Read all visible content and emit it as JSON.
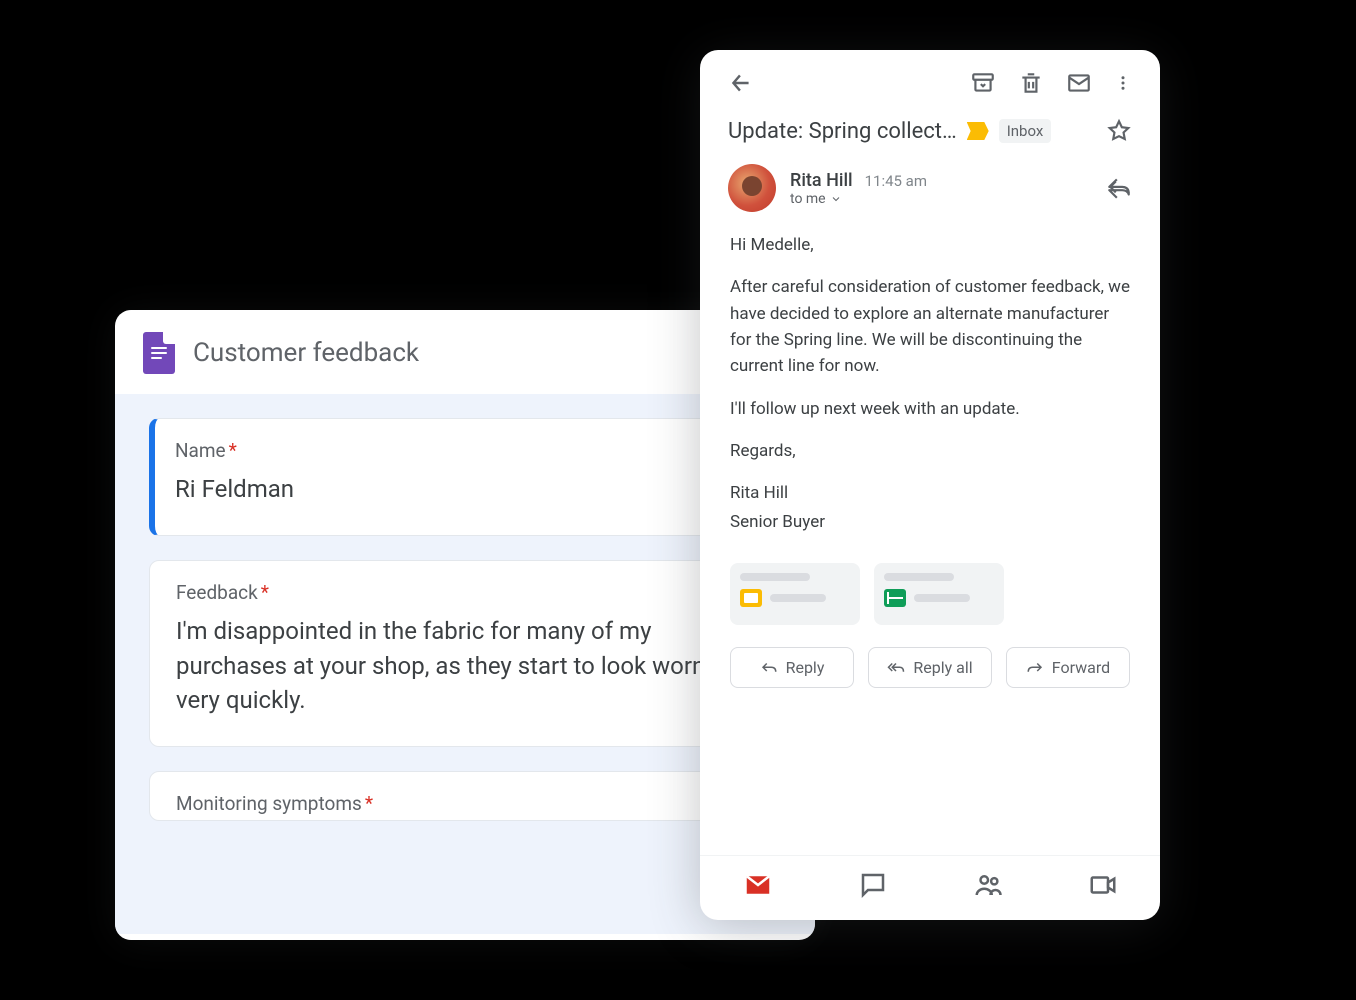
{
  "forms": {
    "title": "Customer feedback",
    "q1": {
      "label": "Name",
      "value": "Ri Feldman"
    },
    "q2": {
      "label": "Feedback",
      "value": "I'm disappointed in the fabric for many of my purchases at your shop, as they start to look worn very quickly."
    },
    "q3": {
      "label": "Monitoring symptoms"
    }
  },
  "gmail": {
    "subject": "Update: Spring collect…",
    "inbox_label": "Inbox",
    "sender": {
      "name": "Rita Hill",
      "time": "11:45 am",
      "to": "to me"
    },
    "body": {
      "greeting": "Hi Medelle,",
      "p1": "After careful consideration of customer feedback, we have decided to explore an alternate manufacturer for the Spring line. We will be discontinuing the current line for now.",
      "p2": "I'll follow up next week with an update.",
      "p3": "Regards,",
      "sig1": "Rita Hill",
      "sig2": "Senior Buyer"
    },
    "actions": {
      "reply": "Reply",
      "reply_all": "Reply all",
      "forward": "Forward"
    }
  }
}
